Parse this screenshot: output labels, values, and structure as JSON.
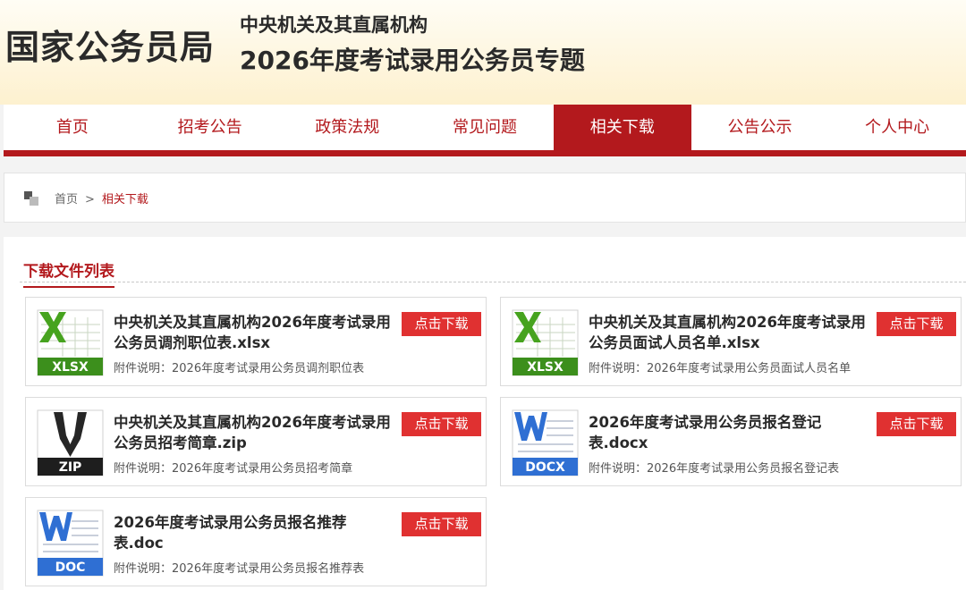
{
  "header": {
    "logo": "国家公务员局",
    "subtitle1": "中央机关及其直属机构",
    "subtitle2": "2026年度考试录用公务员专题"
  },
  "nav": {
    "items": [
      {
        "label": "首页"
      },
      {
        "label": "招考公告"
      },
      {
        "label": "政策法规"
      },
      {
        "label": "常见问题"
      },
      {
        "label": "相关下载"
      },
      {
        "label": "公告公示"
      },
      {
        "label": "个人中心"
      }
    ],
    "active_index": 4
  },
  "breadcrumb": {
    "home": "首页",
    "separator": ">",
    "current": "相关下载"
  },
  "section": {
    "title": "下载文件列表"
  },
  "files": [
    {
      "title": "中央机关及其直属机构2026年度考试录用公务员调剂职位表.xlsx",
      "desc": "附件说明：2026年度考试录用公务员调剂职位表",
      "type": "XLSX",
      "button": "点击下载"
    },
    {
      "title": "中央机关及其直属机构2026年度考试录用公务员面试人员名单.xlsx",
      "desc": "附件说明：2026年度考试录用公务员面试人员名单",
      "type": "XLSX",
      "button": "点击下载"
    },
    {
      "title": "中央机关及其直属机构2026年度考试录用公务员招考简章.zip",
      "desc": "附件说明：2026年度考试录用公务员招考简章",
      "type": "ZIP",
      "button": "点击下载"
    },
    {
      "title": "2026年度考试录用公务员报名登记表.docx",
      "desc": "附件说明：2026年度考试录用公务员报名登记表",
      "type": "DOCX",
      "button": "点击下载"
    },
    {
      "title": "2026年度考试录用公务员报名推荐表.doc",
      "desc": "附件说明：2026年度考试录用公务员报名推荐表",
      "type": "DOC",
      "button": "点击下载"
    }
  ],
  "colors": {
    "brand_red": "#b3191d",
    "button_red": "#e03131",
    "excel_green": "#3c8f1c",
    "word_blue": "#2f6fd3",
    "zip_black": "#1e1e1e"
  }
}
